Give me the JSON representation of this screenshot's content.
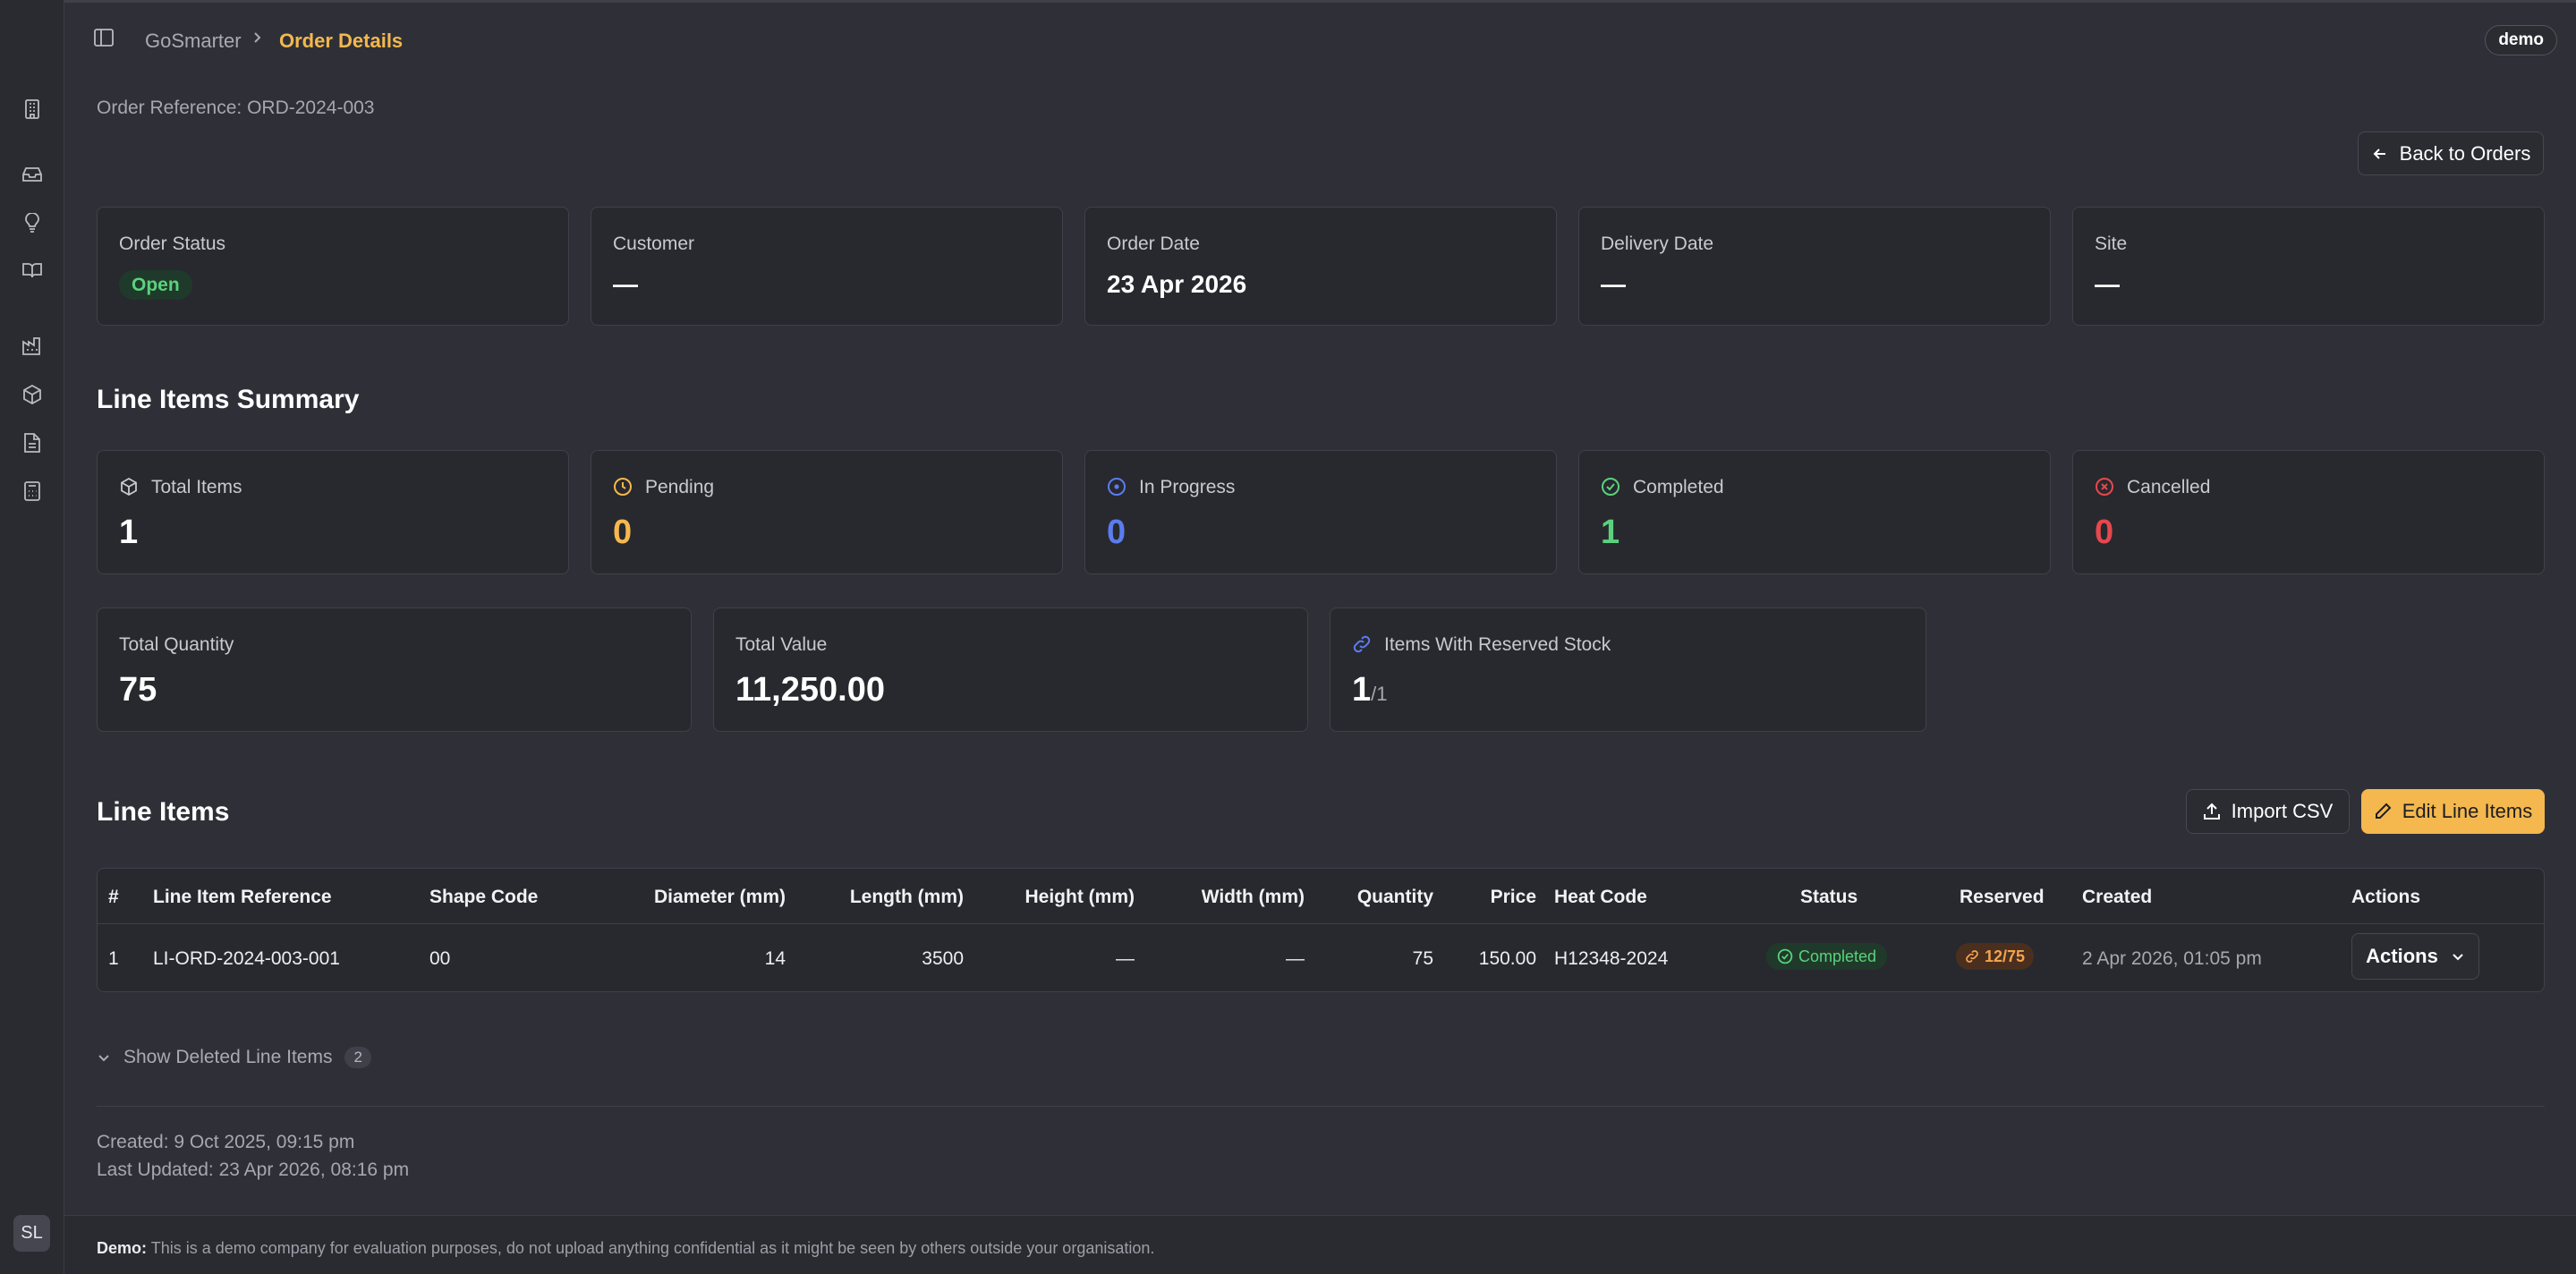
{
  "header": {
    "breadcrumb_root": "GoSmarter",
    "breadcrumb_current": "Order Details",
    "user_badge": "demo"
  },
  "order_reference": "Order Reference: ORD-2024-003",
  "back_button": "Back to Orders",
  "info_cards": {
    "status": {
      "label": "Order Status",
      "value": "Open"
    },
    "customer": {
      "label": "Customer",
      "value": "—"
    },
    "order_date": {
      "label": "Order Date",
      "value": "23 Apr 2026"
    },
    "delivery_date": {
      "label": "Delivery Date",
      "value": "—"
    },
    "site": {
      "label": "Site",
      "value": "—"
    }
  },
  "summary": {
    "title": "Line Items Summary",
    "total_items": {
      "label": "Total Items",
      "value": "1"
    },
    "pending": {
      "label": "Pending",
      "value": "0"
    },
    "in_progress": {
      "label": "In Progress",
      "value": "0"
    },
    "completed": {
      "label": "Completed",
      "value": "1"
    },
    "cancelled": {
      "label": "Cancelled",
      "value": "0"
    },
    "total_quantity": {
      "label": "Total Quantity",
      "value": "75"
    },
    "total_value": {
      "label": "Total Value",
      "value": "11,250.00"
    },
    "reserved_stock": {
      "label": "Items With Reserved Stock",
      "value": "1",
      "suffix": "/1"
    }
  },
  "line_items": {
    "title": "Line Items",
    "import_button": "Import CSV",
    "edit_button": "Edit Line Items",
    "columns": [
      "#",
      "Line Item Reference",
      "Shape Code",
      "Diameter (mm)",
      "Length (mm)",
      "Height (mm)",
      "Width (mm)",
      "Quantity",
      "Price",
      "Heat Code",
      "Status",
      "Reserved",
      "Created",
      "Actions"
    ],
    "rows": [
      {
        "num": "1",
        "reference": "LI-ORD-2024-003-001",
        "shape_code": "00",
        "diameter": "14",
        "length": "3500",
        "height": "—",
        "width": "—",
        "quantity": "75",
        "price": "150.00",
        "heat_code": "H12348-2024",
        "status": "Completed",
        "reserved": "12/75",
        "created": "2 Apr 2026, 01:05 pm",
        "actions": "Actions"
      }
    ]
  },
  "deleted_toggle": {
    "label": "Show Deleted Line Items",
    "count": "2"
  },
  "meta": {
    "created": "Created: 9 Oct 2025, 09:15 pm",
    "updated": "Last Updated: 23 Apr 2026, 08:16 pm"
  },
  "footer": {
    "label": "Demo:",
    "text": "This is a demo company for evaluation purposes, do not upload anything confidential as it might be seen by others outside your organisation."
  },
  "sidebar": {
    "avatar_initials": "SL"
  },
  "colors": {
    "accent": "#f4b84e",
    "success": "#5ad27d",
    "info": "#5b7cf0",
    "danger": "#e5484d",
    "pending": "#f4b84e",
    "reserved": "#f4a34e"
  },
  "icons": [
    "building-icon",
    "inbox-icon",
    "lightbulb-icon",
    "book-icon",
    "factory-icon",
    "box-icon",
    "document-icon",
    "calculator-icon",
    "sidebar-toggle-icon",
    "chevron-right-icon",
    "arrow-left-icon",
    "clock-icon",
    "circle-dot-icon",
    "check-circle-icon",
    "x-circle-icon",
    "link-icon",
    "upload-icon",
    "pencil-icon",
    "chevron-down-icon"
  ]
}
